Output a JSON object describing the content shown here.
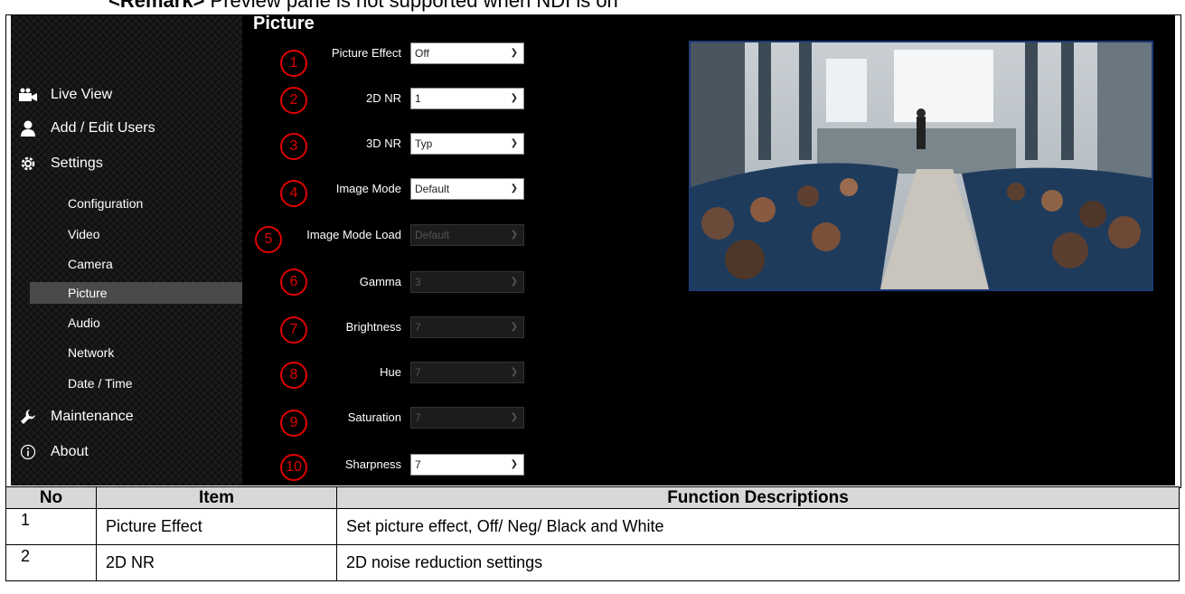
{
  "remark": {
    "prefix": "<Remark>",
    "text": "Preview pane is not supported when NDI is on"
  },
  "page_title": "Picture",
  "nav": {
    "live_view": "Live View",
    "add_edit_users": "Add / Edit Users",
    "settings": "Settings",
    "sub_items": [
      "Configuration",
      "Video",
      "Camera",
      "Picture",
      "Audio",
      "Network",
      "Date / Time"
    ],
    "active_sub": "Picture",
    "maintenance": "Maintenance",
    "about": "About"
  },
  "fields": [
    {
      "num": "1",
      "label": "Picture Effect",
      "value": "Off",
      "enabled": true
    },
    {
      "num": "2",
      "label": "2D NR",
      "value": "1",
      "enabled": true
    },
    {
      "num": "3",
      "label": "3D NR",
      "value": "Typ",
      "enabled": true
    },
    {
      "num": "4",
      "label": "Image Mode",
      "value": "Default",
      "enabled": true
    },
    {
      "num": "5",
      "label": "Image Mode Load",
      "value": "Default",
      "enabled": false
    },
    {
      "num": "6",
      "label": "Gamma",
      "value": "3",
      "enabled": false
    },
    {
      "num": "7",
      "label": "Brightness",
      "value": "7",
      "enabled": false
    },
    {
      "num": "8",
      "label": "Hue",
      "value": "7",
      "enabled": false
    },
    {
      "num": "9",
      "label": "Saturation",
      "value": "7",
      "enabled": false
    },
    {
      "num": "10",
      "label": "Sharpness",
      "value": "7",
      "enabled": true
    }
  ],
  "table": {
    "headers": [
      "No",
      "Item",
      "Function Descriptions"
    ],
    "rows": [
      [
        "1",
        "Picture Effect",
        "Set picture effect, Off/ Neg/ Black and White"
      ],
      [
        "2",
        "2D NR",
        "2D noise reduction settings"
      ]
    ]
  },
  "colors": {
    "badge": "#e00000",
    "active_nav": "#4a4a4a",
    "preview_border": "#1c3a78"
  }
}
